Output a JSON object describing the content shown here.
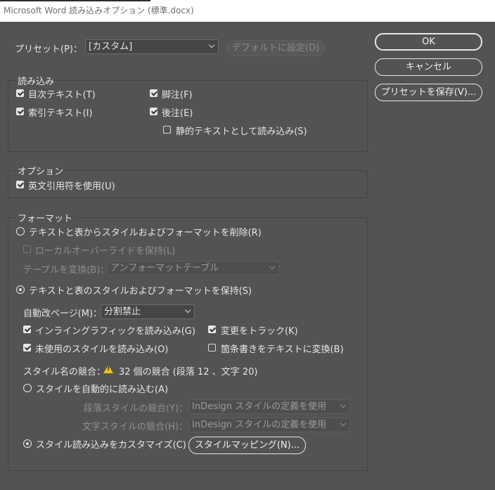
{
  "window": {
    "title": "Microsoft Word 読み込みオプション (標準.docx)"
  },
  "preset": {
    "label": "プリセット(P)：",
    "value": "[カスタム]",
    "default_button": "デフォルトに設定(D)"
  },
  "buttons": {
    "ok": "OK",
    "cancel": "キャンセル",
    "save_preset": "プリセットを保存(V)..."
  },
  "import_group": {
    "title": "読み込み",
    "toc_text": {
      "label": "目次テキスト(T)",
      "checked": true
    },
    "index_text": {
      "label": "索引テキスト(I)",
      "checked": true
    },
    "footnotes": {
      "label": "脚注(F)",
      "checked": true
    },
    "endnotes": {
      "label": "後注(E)",
      "checked": true
    },
    "static_text": {
      "label": "静的テキストとして読み込み(S)",
      "checked": false
    }
  },
  "options_group": {
    "title": "オプション",
    "typographers_quotes": {
      "label": "英文引用符を使用(U)",
      "checked": true
    }
  },
  "format_group": {
    "title": "フォーマット",
    "remove_styles": {
      "label": "テキストと表からスタイルおよびフォーマットを削除(R)",
      "selected": false
    },
    "preserve_local_overrides": {
      "label": "ローカルオーバーライドを保持(L)",
      "checked": false,
      "disabled": true
    },
    "convert_tables": {
      "label": "テーブルを変換(B)：",
      "value": "アンフォーマットテーブル",
      "disabled": true
    },
    "preserve_styles": {
      "label": "テキストと表のスタイルおよびフォーマットを保持(S)",
      "selected": true
    },
    "manual_page_breaks": {
      "label": "自動改ページ(M)：",
      "value": "分割禁止"
    },
    "import_inline_graphics": {
      "label": "インライングラフィックを読み込み(G)",
      "checked": true
    },
    "track_changes": {
      "label": "変更をトラック(K)",
      "checked": true
    },
    "import_unused_styles": {
      "label": "未使用のスタイルを読み込み(O)",
      "checked": true
    },
    "convert_bullets": {
      "label": "箇条書きをテキストに変換(B)",
      "checked": false
    },
    "style_conflicts": {
      "label": "スタイル名の競合：",
      "summary": "32 個の競合 (段落 12 、文字 20)",
      "icon": "warning-icon"
    },
    "auto_import_styles": {
      "label": "スタイルを自動的に読み込む(A)",
      "selected": false
    },
    "paragraph_conflicts": {
      "label": "段落スタイルの競合(Y)：",
      "value": "InDesign スタイルの定義を使用",
      "disabled": true
    },
    "character_conflicts": {
      "label": "文字スタイルの競合(H)：",
      "value": "InDesign スタイルの定義を使用",
      "disabled": true
    },
    "customize_style_import": {
      "label": "スタイル読み込みをカスタマイズ(C)",
      "selected": true
    },
    "style_mapping_button": "スタイルマッピング(N)..."
  },
  "colors": {
    "dialog_bg": "#535353",
    "text": "#e6e6e6",
    "disabled_text": "#8f8f8f",
    "warning": "#f0c020"
  }
}
